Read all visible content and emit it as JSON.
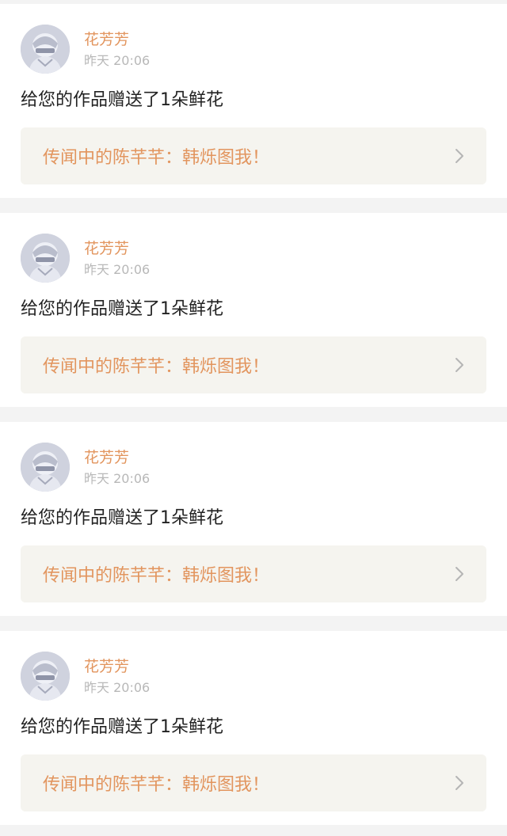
{
  "notifications": [
    {
      "username": "花芳芳",
      "time": "昨天 20:06",
      "message": "给您的作品赠送了1朵鲜花",
      "work_title": "传闻中的陈芊芊：韩烁图我！",
      "avatar_icon": "user-avatar",
      "link_icon": "chevron-right-icon"
    },
    {
      "username": "花芳芳",
      "time": "昨天 20:06",
      "message": "给您的作品赠送了1朵鲜花",
      "work_title": "传闻中的陈芊芊：韩烁图我！",
      "avatar_icon": "user-avatar",
      "link_icon": "chevron-right-icon"
    },
    {
      "username": "花芳芳",
      "time": "昨天 20:06",
      "message": "给您的作品赠送了1朵鲜花",
      "work_title": "传闻中的陈芊芊：韩烁图我！",
      "avatar_icon": "user-avatar",
      "link_icon": "chevron-right-icon"
    },
    {
      "username": "花芳芳",
      "time": "昨天 20:06",
      "message": "给您的作品赠送了1朵鲜花",
      "work_title": "传闻中的陈芊芊：韩烁图我！",
      "avatar_icon": "user-avatar",
      "link_icon": "chevron-right-icon"
    }
  ],
  "colors": {
    "accent": "#e2955e",
    "timestamp": "#b8b8b8",
    "message_text": "#222222",
    "link_background": "#f5f4ef",
    "page_background": "#f3f3f3"
  }
}
